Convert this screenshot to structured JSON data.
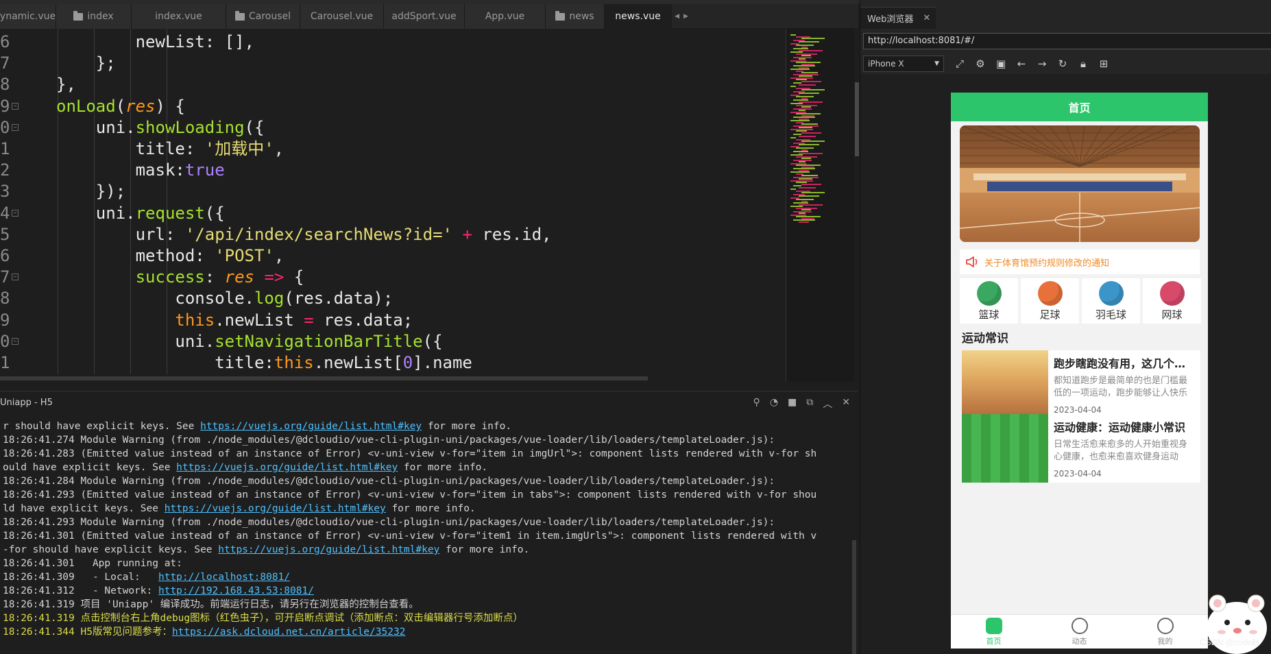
{
  "tabs": [
    {
      "label": "ynamic.vue",
      "folder": false,
      "active": false
    },
    {
      "label": "index",
      "folder": true,
      "active": false
    },
    {
      "label": "index.vue",
      "folder": false,
      "active": false
    },
    {
      "label": "Carousel",
      "folder": true,
      "active": false
    },
    {
      "label": "Carousel.vue",
      "folder": false,
      "active": false
    },
    {
      "label": "addSport.vue",
      "folder": false,
      "active": false
    },
    {
      "label": "App.vue",
      "folder": false,
      "active": false
    },
    {
      "label": "news",
      "folder": true,
      "active": false
    },
    {
      "label": "news.vue",
      "folder": false,
      "active": true
    }
  ],
  "tab_nav_icons": [
    "chevron-left-icon",
    "chevron-right-icon"
  ],
  "editor": {
    "lines": [
      {
        "no": "6",
        "fold": false,
        "html": "        newList: [],"
      },
      {
        "no": "7",
        "fold": false,
        "html": "    };"
      },
      {
        "no": "8",
        "fold": false,
        "html": "},"
      },
      {
        "no": "9",
        "fold": true,
        "html": "<span class=\"k-fn\">onLoad</span>(<span class=\"k-param\">res</span>) {"
      },
      {
        "no": "0",
        "fold": true,
        "html": "    uni.<span class=\"k-fn\">showLoading</span>({"
      },
      {
        "no": "1",
        "fold": false,
        "html": "        title: <span class=\"k-str\">'加载中'</span>,"
      },
      {
        "no": "2",
        "fold": false,
        "html": "        mask:<span class=\"k-bool\">true</span>"
      },
      {
        "no": "3",
        "fold": false,
        "html": "    });"
      },
      {
        "no": "4",
        "fold": true,
        "html": "    uni.<span class=\"k-fn\">request</span>({"
      },
      {
        "no": "5",
        "fold": false,
        "html": "        url: <span class=\"k-str\">'/api/index/searchNews?id='</span> <span class=\"k-kw\">+</span> res.id,"
      },
      {
        "no": "6",
        "fold": false,
        "html": "        method: <span class=\"k-str\">'POST'</span>,"
      },
      {
        "no": "7",
        "fold": true,
        "html": "        <span class=\"k-fn\">success</span>: <span class=\"k-param\">res</span> <span class=\"k-kw\">=&gt;</span> {"
      },
      {
        "no": "8",
        "fold": false,
        "html": "            console.<span class=\"k-fn\">log</span>(res.data);"
      },
      {
        "no": "9",
        "fold": false,
        "html": "            <span class=\"k-param\" style=\"font-style:normal\">this</span>.newList <span class=\"k-kw\">=</span> res.data;"
      },
      {
        "no": "0",
        "fold": true,
        "html": "            uni.<span class=\"k-fn\">setNavigationBarTitle</span>({"
      },
      {
        "no": "1",
        "fold": false,
        "html": "                title:<span class=\"k-param\" style=\"font-style:normal\">this</span>.newList[<span class=\"k-bool\">0</span>].name"
      }
    ]
  },
  "terminal": {
    "title": "Uniapp - H5",
    "tool_icons": [
      "bug-icon",
      "replay-icon",
      "stop-icon",
      "open-external-icon",
      "collapse-icon",
      "close-panel-icon"
    ],
    "lines": [
      {
        "style": "",
        "parts": [
          {
            "t": "r should have explicit keys. See "
          },
          {
            "t": "https://vuejs.org/guide/list.html#key",
            "link": true
          },
          {
            "t": " for more info."
          }
        ]
      },
      {
        "style": "",
        "parts": [
          {
            "t": "18:26:41.274 Module Warning (from ./node_modules/@dcloudio/vue-cli-plugin-uni/packages/vue-loader/lib/loaders/templateLoader.js):"
          }
        ]
      },
      {
        "style": "",
        "parts": [
          {
            "t": "18:26:41.283 (Emitted value instead of an instance of Error) <v-uni-view v-for=\"item in imgUrl\">: component lists rendered with v-for sh"
          }
        ]
      },
      {
        "style": "",
        "parts": [
          {
            "t": "ould have explicit keys. See "
          },
          {
            "t": "https://vuejs.org/guide/list.html#key",
            "link": true
          },
          {
            "t": " for more info."
          }
        ]
      },
      {
        "style": "",
        "parts": [
          {
            "t": "18:26:41.284 Module Warning (from ./node_modules/@dcloudio/vue-cli-plugin-uni/packages/vue-loader/lib/loaders/templateLoader.js):"
          }
        ]
      },
      {
        "style": "",
        "parts": [
          {
            "t": "18:26:41.293 (Emitted value instead of an instance of Error) <v-uni-view v-for=\"item in tabs\">: component lists rendered with v-for shou"
          }
        ]
      },
      {
        "style": "",
        "parts": [
          {
            "t": "ld have explicit keys. See "
          },
          {
            "t": "https://vuejs.org/guide/list.html#key",
            "link": true
          },
          {
            "t": " for more info."
          }
        ]
      },
      {
        "style": "",
        "parts": [
          {
            "t": "18:26:41.293 Module Warning (from ./node_modules/@dcloudio/vue-cli-plugin-uni/packages/vue-loader/lib/loaders/templateLoader.js):"
          }
        ]
      },
      {
        "style": "",
        "parts": [
          {
            "t": "18:26:41.301 (Emitted value instead of an instance of Error) <v-uni-view v-for=\"item1 in item.imgUrls\">: component lists rendered with v"
          }
        ]
      },
      {
        "style": "",
        "parts": [
          {
            "t": "-for should have explicit keys. See "
          },
          {
            "t": "https://vuejs.org/guide/list.html#key",
            "link": true
          },
          {
            "t": " for more info."
          }
        ]
      },
      {
        "style": "",
        "parts": [
          {
            "t": "18:26:41.301   App running at:"
          }
        ]
      },
      {
        "style": "",
        "parts": [
          {
            "t": "18:26:41.309   - Local:   "
          },
          {
            "t": "http://localhost:8081/",
            "link": true
          }
        ]
      },
      {
        "style": "",
        "parts": [
          {
            "t": "18:26:41.312   - Network: "
          },
          {
            "t": "http://192.168.43.53:8081/",
            "link": true
          }
        ]
      },
      {
        "style": "",
        "parts": [
          {
            "t": "18:26:41.319 项目 'Uniapp' 编译成功。前端运行日志，请另行在浏览器的控制台查看。"
          }
        ]
      },
      {
        "style": "yellow",
        "parts": [
          {
            "t": "18:26:41.319 点击控制台右上角debug图标（红色虫子），可开启断点调试（添加断点：双击编辑器行号添加断点）"
          }
        ]
      },
      {
        "style": "yellow",
        "parts": [
          {
            "t": "18:26:41.344 H5版常见问题参考："
          },
          {
            "t": "https://ask.dcloud.net.cn/article/35232",
            "link": true
          }
        ]
      }
    ]
  },
  "browser": {
    "tab_label": "Web浏览器",
    "url": "http://localhost:8081/#/",
    "device": "iPhone X",
    "toolbar_icons": [
      "rotate-icon",
      "settings-icon",
      "devtools-icon",
      "back-icon",
      "forward-icon",
      "refresh-icon",
      "lock-icon",
      "grid-icon"
    ]
  },
  "phone": {
    "nav_title": "首页",
    "notice": "关于体育馆预约规则修改的通知",
    "categories": [
      {
        "label": "篮球",
        "icon": "basketball-icon",
        "color": "#3aa860"
      },
      {
        "label": "足球",
        "icon": "football-icon",
        "color": "#e8703a"
      },
      {
        "label": "羽毛球",
        "icon": "badminton-icon",
        "color": "#3b95c8"
      },
      {
        "label": "网球",
        "icon": "tennis-icon",
        "color": "#d84a6a"
      }
    ],
    "section_title": "运动常识",
    "news": [
      {
        "title": "跑步瞎跑没有用，这几个跑步技巧你一定要知道",
        "desc": "都知道跑步是最简单的也是门槛最低的一项运动，跑步能够让人快乐",
        "date": "2023-04-04"
      },
      {
        "title": "运动健康：运动健康小常识",
        "desc": "日常生活愈来愈多的人开始重视身心健康，也愈来愈喜欢健身运动",
        "date": "2023-04-04"
      }
    ],
    "tabbar": [
      {
        "label": "首页",
        "icon": "home-icon",
        "active": true
      },
      {
        "label": "动态",
        "icon": "message-icon",
        "active": false
      },
      {
        "label": "我的",
        "icon": "smile-icon",
        "active": false
      }
    ]
  },
  "watermark": "CSDN @code赵",
  "colors": {
    "accent_green": "#2dc56b",
    "notice_orange": "#f08a24",
    "link_blue": "#4fc1ff"
  }
}
